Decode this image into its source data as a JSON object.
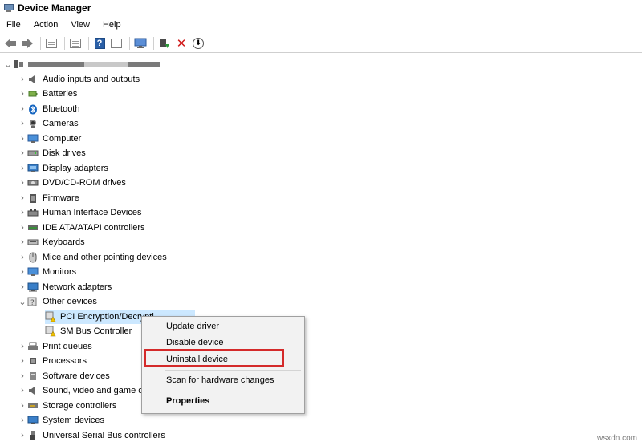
{
  "window": {
    "title": "Device Manager"
  },
  "menu": [
    "File",
    "Action",
    "View",
    "Help"
  ],
  "toolbar": {
    "icons": [
      "back-arrow-icon",
      "forward-arrow-icon",
      "properties-pane-icon",
      "console-tree-icon",
      "help-icon",
      "action-pane-icon",
      "monitor-icon",
      "update-driver-icon",
      "uninstall-icon",
      "scan-icon"
    ],
    "uninstall_glyph": "✕",
    "help_glyph": "?",
    "down_glyph": "⬇"
  },
  "tree": {
    "root": {
      "icon": "computer-icon",
      "expanded": true
    },
    "categories": [
      {
        "label": "Audio inputs and outputs",
        "icon": "speaker-icon"
      },
      {
        "label": "Batteries",
        "icon": "battery-icon"
      },
      {
        "label": "Bluetooth",
        "icon": "bluetooth-icon"
      },
      {
        "label": "Cameras",
        "icon": "camera-icon"
      },
      {
        "label": "Computer",
        "icon": "computer-icon"
      },
      {
        "label": "Disk drives",
        "icon": "disk-icon"
      },
      {
        "label": "Display adapters",
        "icon": "display-adapter-icon"
      },
      {
        "label": "DVD/CD-ROM drives",
        "icon": "dvd-icon"
      },
      {
        "label": "Firmware",
        "icon": "firmware-icon"
      },
      {
        "label": "Human Interface Devices",
        "icon": "hid-icon"
      },
      {
        "label": "IDE ATA/ATAPI controllers",
        "icon": "ide-icon"
      },
      {
        "label": "Keyboards",
        "icon": "keyboard-icon"
      },
      {
        "label": "Mice and other pointing devices",
        "icon": "mouse-icon"
      },
      {
        "label": "Monitors",
        "icon": "monitor-icon"
      },
      {
        "label": "Network adapters",
        "icon": "network-icon"
      },
      {
        "label": "Other devices",
        "icon": "unknown-device-icon",
        "expanded": true,
        "children": [
          {
            "label": "PCI Encryption/Decrypti",
            "icon": "warning-device-icon",
            "selected": true
          },
          {
            "label": "SM Bus Controller",
            "icon": "warning-device-icon"
          }
        ]
      },
      {
        "label": "Print queues",
        "icon": "printer-icon"
      },
      {
        "label": "Processors",
        "icon": "processor-icon"
      },
      {
        "label": "Software devices",
        "icon": "software-device-icon"
      },
      {
        "label": "Sound, video and game co",
        "icon": "sound-icon"
      },
      {
        "label": "Storage controllers",
        "icon": "storage-icon"
      },
      {
        "label": "System devices",
        "icon": "system-icon"
      },
      {
        "label": "Universal Serial Bus controllers",
        "icon": "usb-icon"
      }
    ]
  },
  "context_menu": {
    "items": [
      {
        "label": "Update driver"
      },
      {
        "label": "Disable device"
      },
      {
        "label": "Uninstall device",
        "highlighted": true
      },
      {
        "label": "Scan for hardware changes"
      },
      {
        "label": "Properties",
        "bold": true
      }
    ]
  },
  "watermark": "wsxdn.com",
  "colors": {
    "highlight": "#d42a2a",
    "selection": "#cce8ff",
    "toolbar_accent": "#2a5fa6"
  }
}
